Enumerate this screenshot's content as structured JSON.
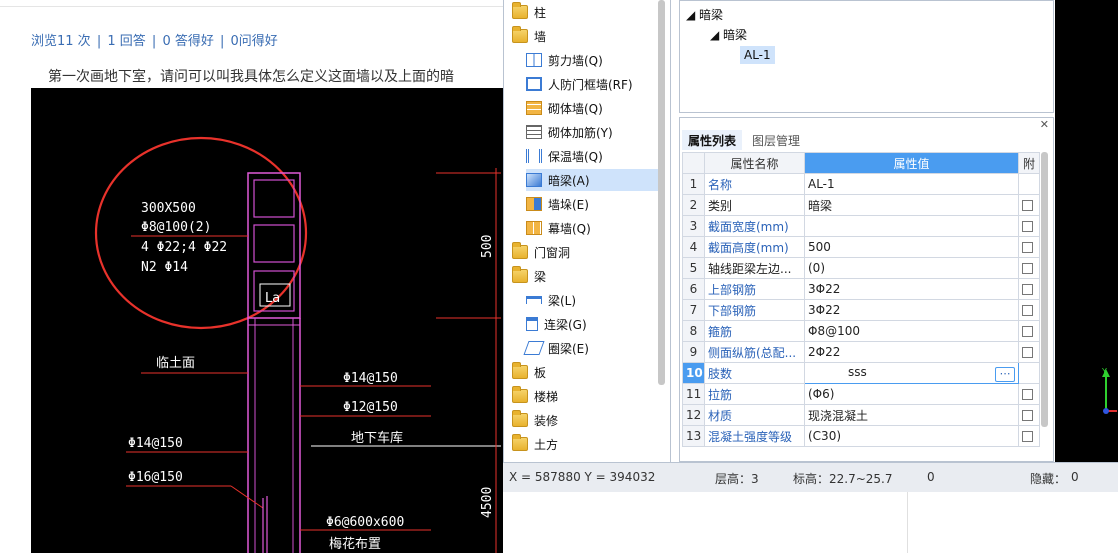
{
  "web": {
    "stats": [
      "浏览11 次",
      "|",
      "1 回答",
      "|",
      "0 答得好",
      "|",
      "0问得好"
    ],
    "question": "第一次画地下室，请问可以叫我具体怎么定义这面墙以及上面的暗",
    "cad_labels": {
      "spec1": "300X500",
      "spec2": "Φ8@100(2)",
      "spec3": "4 Φ22;4 Φ22",
      "spec4": "N2 Φ14",
      "la": "La",
      "dim500": "500",
      "dim4500": "4500",
      "rebar1": "Φ14@150",
      "rebar2": "Φ12@150",
      "rebar3": "Φ14@150",
      "rebar4": "Φ16@150",
      "rebar5": "Φ6@600x600",
      "label_top": "临土面",
      "label_garage": "地下车库",
      "label_bottom": "梅花布置"
    }
  },
  "tree": {
    "items": [
      {
        "label": "柱",
        "level": 0,
        "type": "folder"
      },
      {
        "label": "墙",
        "level": 0,
        "type": "folder-open"
      },
      {
        "label": "剪力墙(Q)",
        "level": 1,
        "type": "shear-wall"
      },
      {
        "label": "人防门框墙(RF)",
        "level": 1,
        "type": "door-frame-wall"
      },
      {
        "label": "砌体墙(Q)",
        "level": 1,
        "type": "masonry-wall"
      },
      {
        "label": "砌体加筋(Y)",
        "level": 1,
        "type": "masonry-rebar"
      },
      {
        "label": "保温墙(Q)",
        "level": 1,
        "type": "insulation-wall"
      },
      {
        "label": "暗梁(A)",
        "level": 1,
        "type": "hidden-beam",
        "selected": true
      },
      {
        "label": "墙垛(E)",
        "level": 1,
        "type": "wall-pier"
      },
      {
        "label": "幕墙(Q)",
        "level": 1,
        "type": "curtain-wall"
      },
      {
        "label": "门窗洞",
        "level": 0,
        "type": "folder"
      },
      {
        "label": "梁",
        "level": 0,
        "type": "folder-open"
      },
      {
        "label": "梁(L)",
        "level": 1,
        "type": "beam"
      },
      {
        "label": "连梁(G)",
        "level": 1,
        "type": "coupling-beam"
      },
      {
        "label": "圈梁(E)",
        "level": 1,
        "type": "ring-beam"
      },
      {
        "label": "板",
        "level": 0,
        "type": "folder"
      },
      {
        "label": "楼梯",
        "level": 0,
        "type": "folder"
      },
      {
        "label": "装修",
        "level": 0,
        "type": "folder"
      },
      {
        "label": "土方",
        "level": 0,
        "type": "folder"
      }
    ]
  },
  "rtree": {
    "root": "暗梁",
    "child": "暗梁",
    "leaf": "AL-1"
  },
  "props": {
    "tabs": [
      "属性列表",
      "图层管理"
    ],
    "head_name": "属性名称",
    "head_value": "属性值",
    "head_extra": "附",
    "rows": [
      {
        "num": "1",
        "name": "名称",
        "value": "AL-1",
        "check": false
      },
      {
        "num": "2",
        "name": "类别",
        "value": "暗梁",
        "check": true,
        "black": true
      },
      {
        "num": "3",
        "name": "截面宽度(mm)",
        "value": "",
        "check": true
      },
      {
        "num": "4",
        "name": "截面高度(mm)",
        "value": "500",
        "check": true
      },
      {
        "num": "5",
        "name": "轴线距梁左边...",
        "value": "(0)",
        "check": true,
        "black": true
      },
      {
        "num": "6",
        "name": "上部钢筋",
        "value": "3Φ22",
        "check": true
      },
      {
        "num": "7",
        "name": "下部钢筋",
        "value": "3Φ22",
        "check": true
      },
      {
        "num": "8",
        "name": "箍筋",
        "value": "Φ8@100",
        "check": true
      },
      {
        "num": "9",
        "name": "侧面纵筋(总配...",
        "value": "2Φ22",
        "check": true
      },
      {
        "num": "10",
        "name": "肢数",
        "value": "sss",
        "check": false,
        "current": true
      },
      {
        "num": "11",
        "name": "拉筋",
        "value": "(Φ6)",
        "check": true
      },
      {
        "num": "12",
        "name": "材质",
        "value": "现浇混凝土",
        "check": true
      },
      {
        "num": "13",
        "name": "混凝土强度等级",
        "value": "(C30)",
        "check": true
      }
    ]
  },
  "status": {
    "coords": "X = 587880 Y = 394032",
    "floor_height": "层高：3",
    "elevation": "标高：22.7~25.7",
    "zero": "0",
    "hidden": "隐藏：",
    "hidden_count": "0"
  }
}
